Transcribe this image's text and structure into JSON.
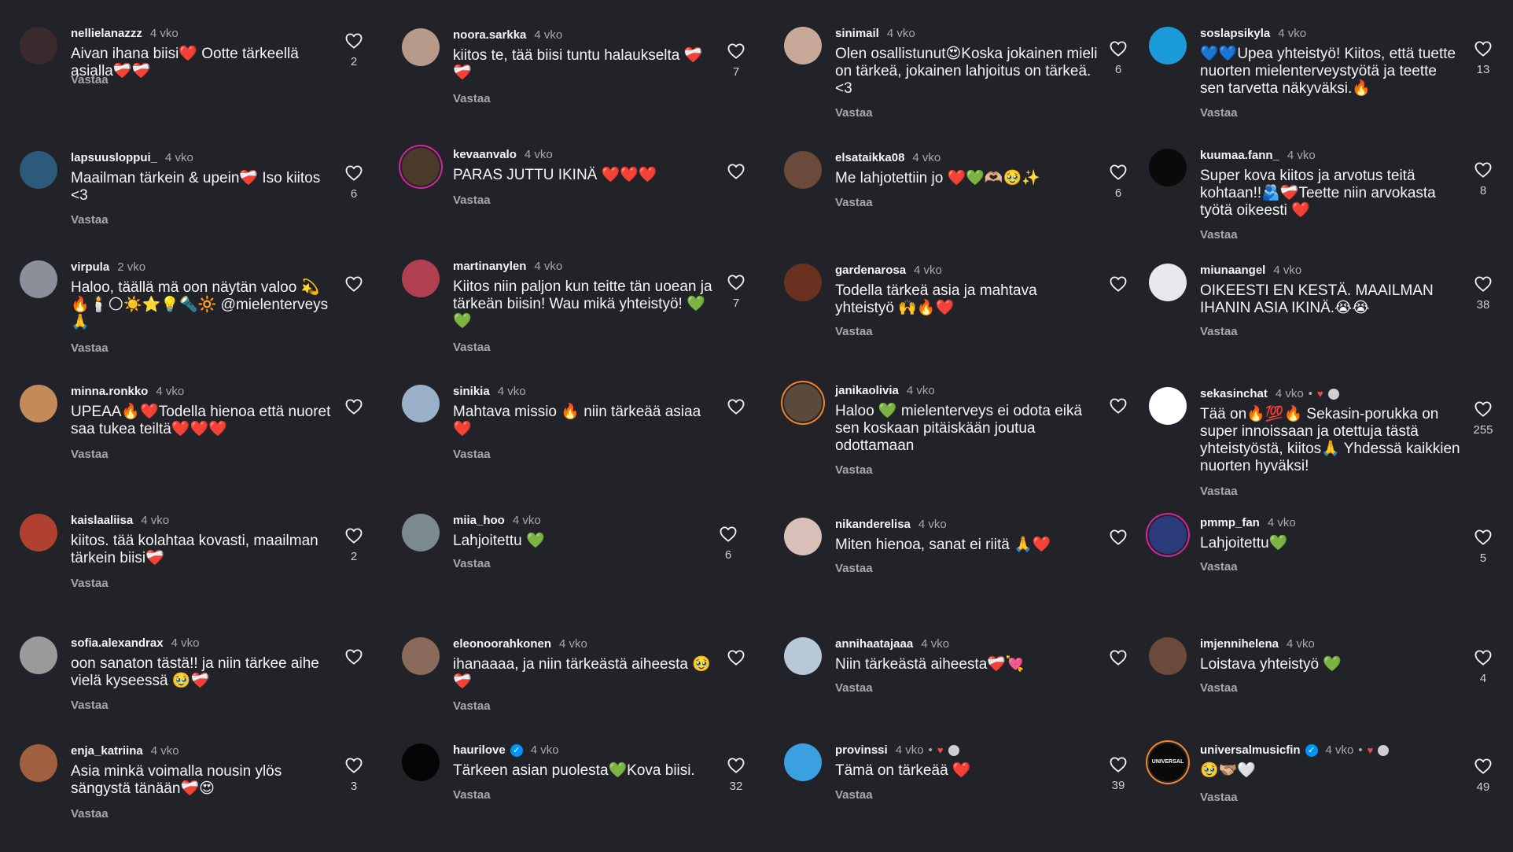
{
  "reply_label": "Vastaa",
  "columns": [
    [
      {
        "user": "nellielanazzz",
        "time": "4 vko",
        "text": "Aivan ihana biisi❤️ Ootte tärkeellä asialla❤️‍🩹❤️‍🩹",
        "likes": "2",
        "avatar_color": "#3a2a2e"
      },
      {
        "user": "lapsuusloppui_",
        "time": "4 vko",
        "text": "Maailman tärkein & upein❤️‍🩹 Iso kiitos <3",
        "likes": "6",
        "avatar_color": "#2d5a7a"
      },
      {
        "user": "virpula",
        "time": "2 vko",
        "text": "Haloo, täällä mä oon näytän valoo 💫🔥🕯️🌕☀️⭐💡🔦🔆 @mielenterveys 🙏",
        "likes": "",
        "avatar_color": "#8a8f9a"
      },
      {
        "user": "minna.ronkko",
        "time": "4 vko",
        "text": "UPEAA🔥❤️Todella hienoa että nuoret saa tukea teiltä❤️❤️❤️",
        "likes": "",
        "avatar_color": "#c58a5a"
      },
      {
        "user": "kaislaaliisa",
        "time": "4 vko",
        "text": "kiitos. tää kolahtaa kovasti, maailman tärkein biisi❤️‍🩹",
        "likes": "2",
        "avatar_color": "#b04030"
      },
      {
        "user": "sofia.alexandrax",
        "time": "4 vko",
        "text": "oon sanaton tästä!! ja niin tärkee aihe vielä kyseessä 🥹❤️‍🩹",
        "likes": "",
        "avatar_color": "#9a9a9a"
      },
      {
        "user": "enja_katriina",
        "time": "4 vko",
        "text": "Asia minkä voimalla nousin ylös sängystä tänään❤️‍🩹😍",
        "likes": "3",
        "avatar_color": "#a06040"
      }
    ],
    [
      {
        "user": "noora.sarkka",
        "time": "4 vko",
        "text": "kiitos te, tää biisi tuntu halaukselta ❤️‍🩹❤️‍🩹",
        "likes": "7",
        "avatar_color": "#b89a8a"
      },
      {
        "user": "kevaanvalo",
        "time": "4 vko",
        "text": "PARAS JUTTU IKINÄ ❤️❤️❤️",
        "likes": "",
        "avatar_color": "#4a3a2a"
      },
      {
        "user": "martinanylen",
        "time": "4 vko",
        "text": "Kiitos niin paljon kun teitte tän uoean ja tärkeän biisin! Wau mikä yhteistyö! 💚💚",
        "likes": "7",
        "avatar_color": "#b04050"
      },
      {
        "user": "sinikia",
        "time": "4 vko",
        "text": "Mahtava missio 🔥 niin tärkeää asiaa ❤️",
        "likes": "",
        "avatar_color": "#9ab0c8"
      },
      {
        "user": "miia_hoo",
        "time": "4 vko",
        "text": "Lahjoitettu 💚",
        "likes": "6",
        "avatar_color": "#7a8a90"
      },
      {
        "user": "eleonoorahkonen",
        "time": "4 vko",
        "text": "ihanaaaa, ja niin tärkeästä aiheesta 🥹❤️‍🩹",
        "likes": "",
        "avatar_color": "#8a6a5a"
      },
      {
        "user": "haurilove",
        "time": "4 vko",
        "text": "Tärkeen asian puolesta💚Kova biisi.",
        "likes": "32",
        "avatar_color": "#050505",
        "verified": true
      }
    ],
    [
      {
        "user": "sinimail",
        "time": "4 vko",
        "text": "Olen osallistunut😍Koska jokainen mieli on tärkeä, jokainen lahjoitus on tärkeä. <3",
        "likes": "6",
        "avatar_color": "#c8a898"
      },
      {
        "user": "elsataikka08",
        "time": "4 vko",
        "text": "Me lahjotettiin jo ❤️💚🫶🏼🥹✨",
        "likes": "6",
        "avatar_color": "#6a4a3a"
      },
      {
        "user": "gardenarosa",
        "time": "4 vko",
        "text": "Todella tärkeä asia ja mahtava yhteistyö 🙌🔥❤️",
        "likes": "",
        "avatar_color": "#6a3020"
      },
      {
        "user": "janikaolivia",
        "time": "4 vko",
        "text": "Haloo 💚 mielenterveys ei odota eikä sen koskaan pitäiskään joutua odottamaan",
        "likes": "",
        "avatar_color": "#5a4a3a"
      },
      {
        "user": "nikanderelisa",
        "time": "4 vko",
        "text": "Miten hienoa, sanat ei riitä 🙏❤️",
        "likes": "",
        "avatar_color": "#d8c0b8"
      },
      {
        "user": "annihaatajaaa",
        "time": "4 vko",
        "text": "Niin tärkeästä aiheesta❤️‍🩹💘",
        "likes": "",
        "avatar_color": "#b8c8d8"
      },
      {
        "user": "provinssi",
        "time": "4 vko",
        "text": "Tämä on tärkeää ❤️",
        "likes": "39",
        "avatar_color": "#3aa0e0"
      }
    ],
    [
      {
        "user": "soslapsikyla",
        "time": "4 vko",
        "text": "💙💙Upea yhteistyö! Kiitos, että tuette nuorten mielenterveystyötä ja teette sen tarvetta näkyväksi.🔥",
        "likes": "13",
        "avatar_color": "#1a9ad8"
      },
      {
        "user": "kuumaa.fann_",
        "time": "4 vko",
        "text": "Super kova kiitos ja arvotus teitä kohtaan!!🫂❤️‍🩹Teette niin arvokasta työtä oikeesti ❤️",
        "likes": "8",
        "avatar_color": "#0a0a0a"
      },
      {
        "user": "miunaangel",
        "time": "4 vko",
        "text": "OIKEESTI EN KESTÄ. MAAILMAN IHANIN ASIA IKINÄ.😭😭",
        "likes": "38",
        "avatar_color": "#e8e8ee"
      },
      {
        "user": "sekasinchat",
        "time": "4 vko",
        "text": "Tää on🔥💯🔥 Sekasin-porukka on super innoissaan ja otettuja tästä yhteistyöstä, kiitos🙏 Yhdessä kaikkien nuorten hyväksi!",
        "likes": "255",
        "avatar_color": "#ffffff",
        "avatar_label": "SE KAS IN"
      },
      {
        "user": "pmmp_fan",
        "time": "4 vko",
        "text": "Lahjoitettu💚",
        "likes": "5",
        "avatar_color": "#2a3a7a"
      },
      {
        "user": "imjennihelena",
        "time": "4 vko",
        "text": "Loistava yhteistyö 💚",
        "likes": "4",
        "avatar_color": "#6a4a3a"
      },
      {
        "user": "universalmusicfin",
        "time": "4 vko",
        "text": "🥹🫱🏼‍🫲🏽🤍",
        "likes": "49",
        "avatar_color": "#0a0a0a",
        "verified": true,
        "avatar_label": "UNIVERSAL"
      }
    ]
  ]
}
